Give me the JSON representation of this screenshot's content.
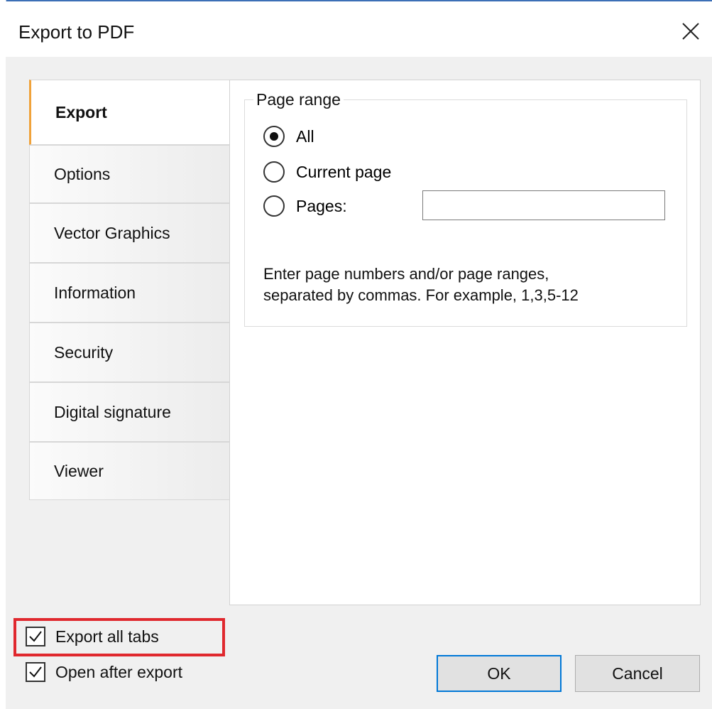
{
  "window": {
    "title": "Export to PDF"
  },
  "tabs": [
    {
      "label": "Export",
      "active": true
    },
    {
      "label": "Options",
      "active": false
    },
    {
      "label": "Vector Graphics",
      "active": false
    },
    {
      "label": "Information",
      "active": false
    },
    {
      "label": "Security",
      "active": false
    },
    {
      "label": "Digital signature",
      "active": false
    },
    {
      "label": "Viewer",
      "active": false
    }
  ],
  "page_range": {
    "group_label": "Page range",
    "options": [
      {
        "label": "All",
        "checked": true
      },
      {
        "label": "Current page",
        "checked": false
      },
      {
        "label": "Pages:",
        "checked": false
      }
    ],
    "pages_value": "",
    "hint_line1": "Enter page numbers and/or page ranges,",
    "hint_line2": "separated by commas. For example, 1,3,5-12"
  },
  "footer": {
    "export_all_tabs": {
      "label": "Export all tabs",
      "checked": true
    },
    "open_after_export": {
      "label": "Open after export",
      "checked": true
    },
    "ok_label": "OK",
    "cancel_label": "Cancel"
  },
  "colors": {
    "active_tab_accent": "#f0a23a",
    "highlight": "#e0282e",
    "default_button_border": "#0078d7"
  }
}
